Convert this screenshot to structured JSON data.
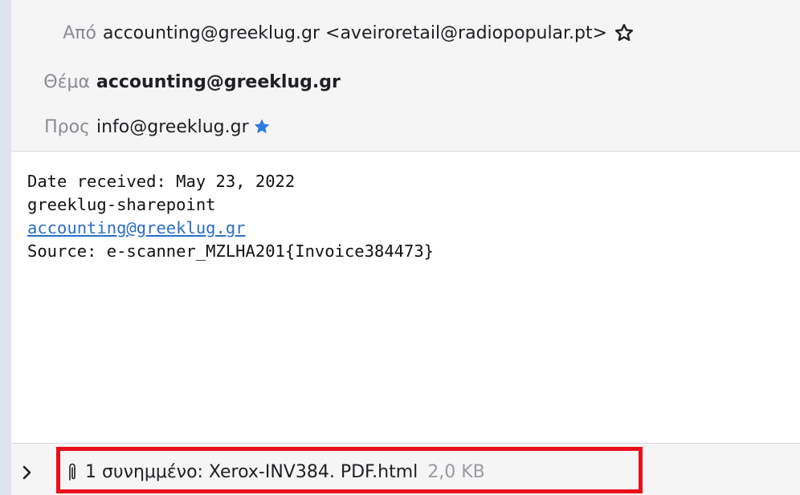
{
  "header": {
    "from_label": "Από",
    "from_value": "accounting@greeklug.gr <aveiroretail@radiopopular.pt>",
    "subject_label": "Θέμα",
    "subject_value": "accounting@greeklug.gr",
    "to_label": "Προς",
    "to_value": "info@greeklug.gr"
  },
  "message": {
    "line1": "Date received: May 23, 2022",
    "line2": "greeklug-sharepoint",
    "link": "accounting@greeklug.gr",
    "line4": "Source: e-scanner_MZLHA201{Invoice384473}"
  },
  "attachments": {
    "summary": "1 συνημμένο: Xerox-INV384. PDF.html",
    "size": "2,0 KB"
  },
  "colors": {
    "highlight": "#e8101a",
    "star": "#2a7ae2",
    "link": "#2a6fc9"
  },
  "icons": {
    "from_star": "star-outline-icon",
    "to_star": "star-filled-icon",
    "attachment": "paperclip-icon",
    "toggle": "chevron-right-icon"
  }
}
